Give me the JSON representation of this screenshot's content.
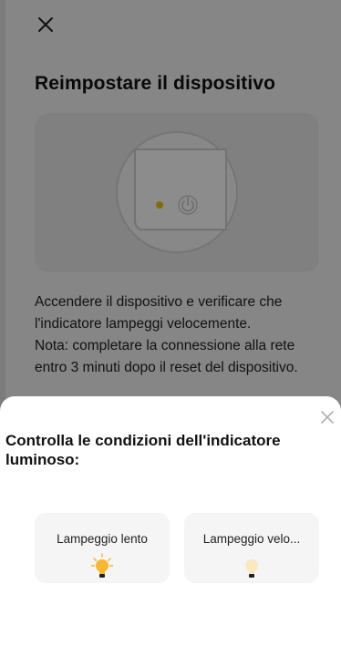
{
  "header": {
    "close_icon": "close-icon"
  },
  "page": {
    "title": "Reimpostare il dispositivo",
    "instructions": [
      "Accendere il dispositivo e verificare che l'indicatore lampeggi velocemente.",
      "Nota: completare la connessione alla rete entro 3 minuti dopo il reset del dispositivo."
    ]
  },
  "sheet": {
    "close_icon": "close-icon",
    "title": "Controlla le condizioni dell'indicatore luminoso:",
    "options": [
      {
        "label": "Lampeggio lento",
        "icon": "bulb-blinking-icon"
      },
      {
        "label": "Lampeggio velo...",
        "icon": "bulb-icon"
      }
    ]
  },
  "colors": {
    "bulb_on": "#f7b733",
    "bulb_dim": "#fbe7c2",
    "indicator_led": "#f1c40f",
    "overlay": "rgba(0,0,0,0.45)"
  }
}
